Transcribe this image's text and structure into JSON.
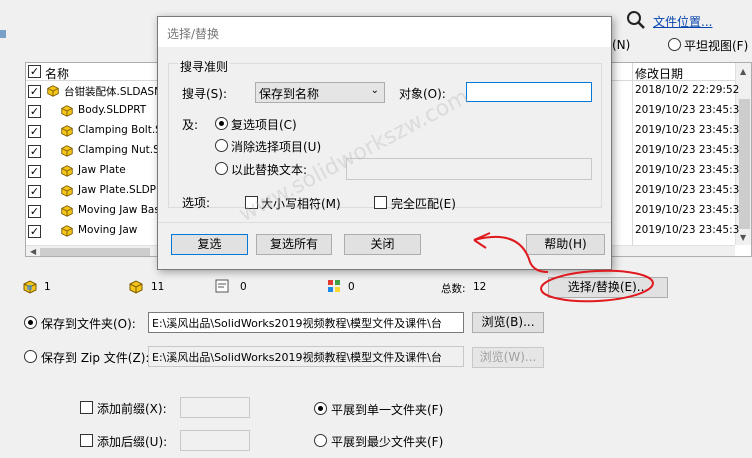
{
  "header": {
    "file_location_link": "文件位置...",
    "flat_view_suffix": "(N)",
    "flat_view_label": "平坦视图(F)"
  },
  "table": {
    "columns": {
      "name": "名称",
      "modified": "修改日期"
    },
    "rows": [
      {
        "name": "台钳装配体.SLDASM",
        "date": "2018/10/2 22:29:52"
      },
      {
        "name": "Body.SLDPRT",
        "date": "2019/10/23 23:45:3"
      },
      {
        "name": "Clamping Bolt.SL",
        "date": "2019/10/23 23:45:3"
      },
      {
        "name": "Clamping Nut.SL",
        "date": "2019/10/23 23:45:3"
      },
      {
        "name": "Jaw Plate",
        "date": "2019/10/23 23:45:3"
      },
      {
        "name": "Jaw Plate.SLDP",
        "date": "2019/10/23 23:45:3"
      },
      {
        "name": "Moving Jaw Bas",
        "date": "2019/10/23 23:45:3"
      },
      {
        "name": "Moving Jaw",
        "date": "2019/10/23 23:45:3"
      }
    ]
  },
  "stats": {
    "assemblies": "1",
    "parts": "11",
    "drawings": "0",
    "other": "0",
    "total_label": "总数:",
    "total": "12"
  },
  "actions": {
    "select_replace": "选择/替换(E)..."
  },
  "save_folder": {
    "label": "保存到文件夹(O):",
    "path": "E:\\溪风出品\\SolidWorks2019视频教程\\模型文件及课件\\台",
    "browse": "浏览(B)..."
  },
  "save_zip": {
    "label": "保存到 Zip 文件(Z):",
    "path": "E:\\溪风出品\\SolidWorks2019视频教程\\模型文件及课件\\台",
    "browse": "浏览(W)..."
  },
  "prefix": {
    "label": "添加前缀(X):"
  },
  "suffix": {
    "label": "添加后缀(U):"
  },
  "flatten": {
    "single": "平展到单一文件夹(F)",
    "fewest": "平展到最少文件夹(F)"
  },
  "dialog": {
    "title": "选择/替换",
    "group_title": "搜寻准则",
    "search_label": "搜寻(S):",
    "search_value": "保存到名称",
    "object_label": "对象(O):",
    "object_value": "",
    "and_label": "及:",
    "opt_select": "复选项目(C)",
    "opt_deselect": "消除选择项目(U)",
    "opt_replace": "以此替换文本:",
    "options_label": "选项:",
    "match_case": "大小写相符(M)",
    "whole_match": "完全匹配(E)",
    "btn_select": "复选",
    "btn_select_all": "复选所有",
    "btn_close": "关闭",
    "btn_help": "帮助(H)"
  },
  "watermark": "www.solidworkszw.com",
  "colors": {
    "annotation_red": "#e0191e",
    "link_blue": "#0645ad",
    "part_yellow": "#f5c518"
  }
}
